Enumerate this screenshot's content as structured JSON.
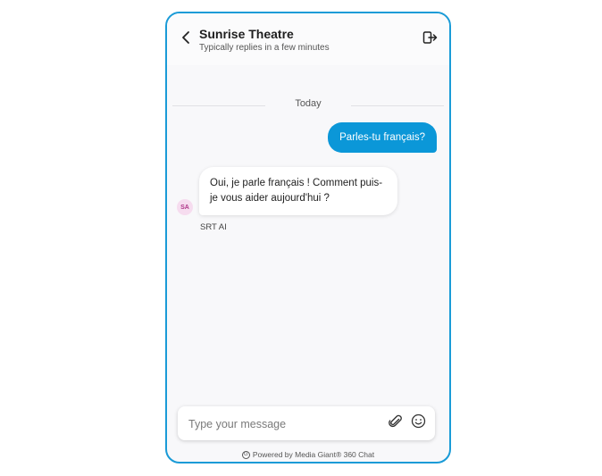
{
  "header": {
    "title": "Sunrise Theatre",
    "subtitle": "Typically replies in a few minutes",
    "back_icon": "chevron-left-icon",
    "exit_icon": "exit-icon"
  },
  "conversation": {
    "date_divider": "Today",
    "messages": [
      {
        "from": "user",
        "text": "Parles-tu français?"
      },
      {
        "from": "bot",
        "text": "Oui, je parle français ! Comment puis-je vous aider aujourd'hui ?",
        "avatar": "SA",
        "sender": "SRT AI"
      }
    ]
  },
  "composer": {
    "placeholder": "Type your message",
    "attach_icon": "paperclip-icon",
    "emoji_icon": "smiley-icon"
  },
  "footer": {
    "text": "Powered by Media Giant® 360 Chat"
  },
  "colors": {
    "accent": "#0b97d8",
    "border": "#1a9bd7",
    "avatar_bg": "#f6dcef"
  }
}
